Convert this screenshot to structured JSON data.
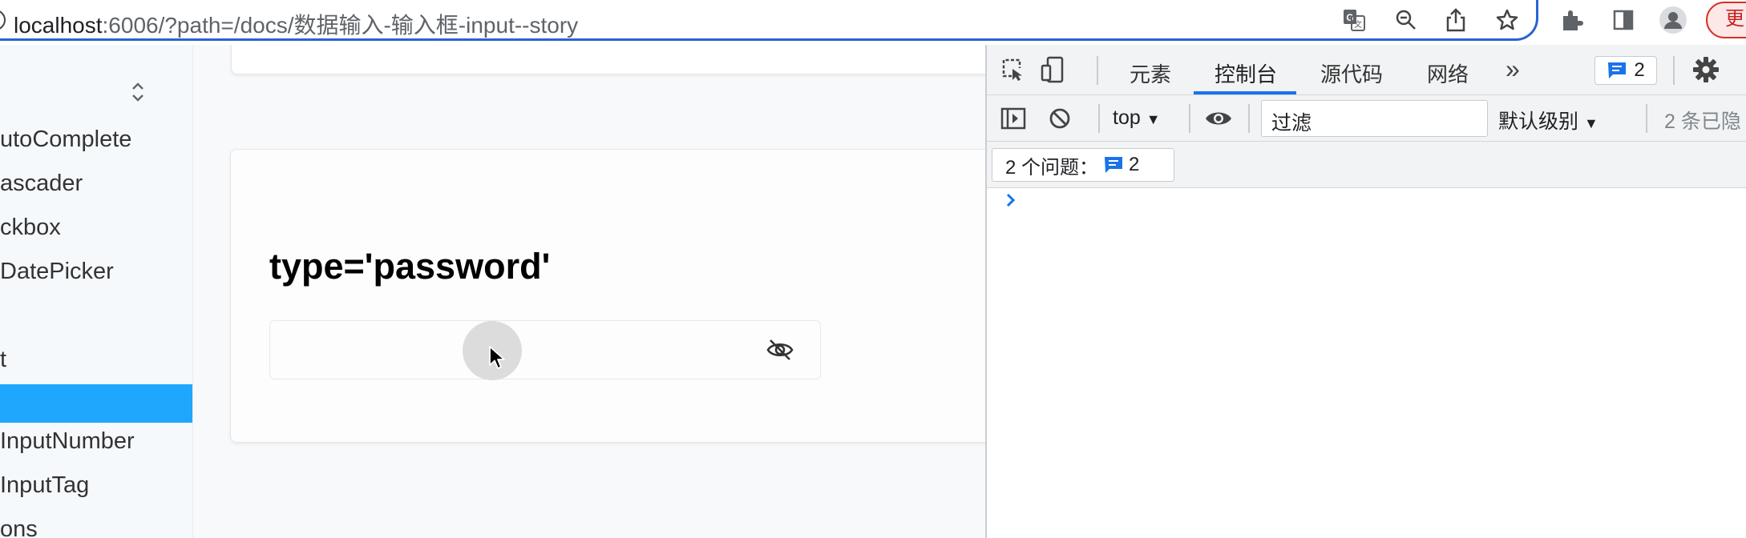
{
  "browser": {
    "url_host": "localhost",
    "url_rest": ":6006/?path=/docs/数据输入-输入框-input--story",
    "update_label": "更",
    "icons": [
      "translate-icon",
      "zoom-icon",
      "share-icon",
      "bookmark-star-icon",
      "extensions-icon",
      "side-panel-icon",
      "profile-icon"
    ]
  },
  "sidebar": {
    "items": [
      {
        "label": "utoComplete"
      },
      {
        "label": "ascader"
      },
      {
        "label": "ckbox"
      },
      {
        "label": "DatePicker"
      },
      {
        "label": "t"
      },
      {
        "label": ""
      },
      {
        "label": "InputNumber"
      },
      {
        "label": "InputTag"
      },
      {
        "label": "ons"
      }
    ],
    "active_color": "#1ea7fd"
  },
  "main": {
    "demo_title": "type='password'",
    "password_input": {
      "value": ""
    }
  },
  "devtools": {
    "tabs": [
      {
        "label": "元素",
        "active": false
      },
      {
        "label": "控制台",
        "active": true
      },
      {
        "label": "源代码",
        "active": false
      },
      {
        "label": "网络",
        "active": false
      }
    ],
    "more_tabs": "»",
    "issues_badge_count": "2",
    "toolbar": {
      "context": "top",
      "filter_placeholder": "过滤",
      "level": "默认级别",
      "hidden_count": "2 条已隐"
    },
    "issues_row": {
      "label": "2 个问题：",
      "count": "2"
    },
    "accent_color": "#1a73e8"
  }
}
